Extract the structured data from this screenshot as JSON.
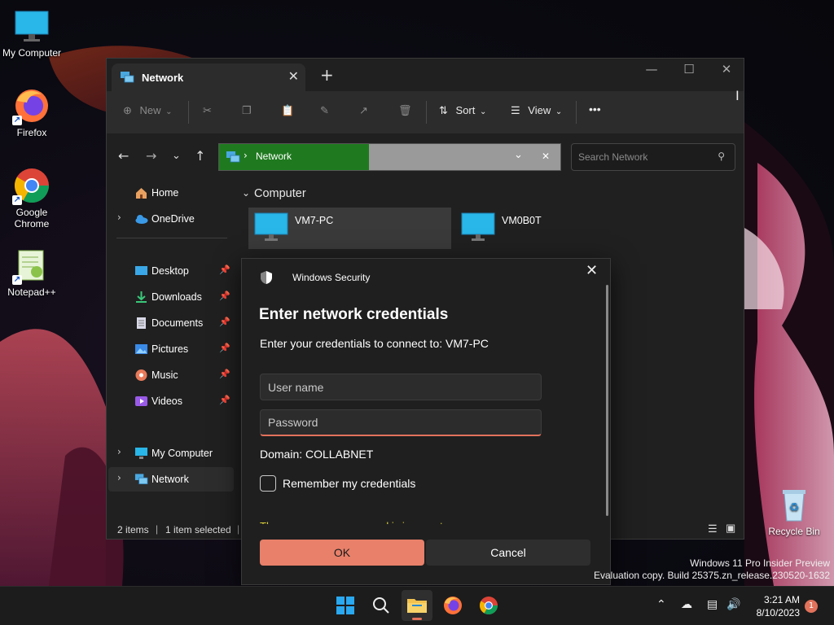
{
  "desktop": {
    "icons": [
      {
        "label": "My Computer"
      },
      {
        "label": "Firefox"
      },
      {
        "label": "Google Chrome"
      },
      {
        "label": "Notepad++"
      },
      {
        "label": "Recycle Bin"
      }
    ],
    "watermark_line1": "Windows 11 Pro Insider Preview",
    "watermark_line2": "Evaluation copy. Build 25375.zn_release.230520-1632"
  },
  "explorer": {
    "tab_title": "Network",
    "toolbar": {
      "new_label": "New",
      "sort_label": "Sort",
      "view_label": "View",
      "more_label": "•••"
    },
    "address": {
      "location": "Network"
    },
    "search": {
      "placeholder": "Search Network"
    },
    "sidebar": {
      "items": [
        {
          "label": "Home"
        },
        {
          "label": "OneDrive"
        },
        {
          "label": "Desktop"
        },
        {
          "label": "Downloads"
        },
        {
          "label": "Documents"
        },
        {
          "label": "Pictures"
        },
        {
          "label": "Music"
        },
        {
          "label": "Videos"
        },
        {
          "label": "My Computer"
        },
        {
          "label": "Network"
        }
      ]
    },
    "content": {
      "group_header": "Computer",
      "items": [
        {
          "name": "VM7-PC"
        },
        {
          "name": "VM0B0T"
        }
      ]
    },
    "status": {
      "count": "2 items",
      "selection": "1 item selected"
    }
  },
  "dialog": {
    "title": "Windows Security",
    "heading": "Enter network credentials",
    "subtitle": "Enter your credentials to connect to: VM7-PC",
    "username_placeholder": "User name",
    "password_placeholder": "Password",
    "domain": "Domain: COLLABNET",
    "remember_label": "Remember my credentials",
    "error": "The username or password is incorrect.",
    "ok_label": "OK",
    "cancel_label": "Cancel"
  },
  "taskbar": {
    "time": "3:21 AM",
    "date": "8/10/2023",
    "notification_count": "1"
  },
  "colors": {
    "accent": "#e8806a",
    "error": "#d9cf3c",
    "selection_green": "#1f7a1f"
  }
}
